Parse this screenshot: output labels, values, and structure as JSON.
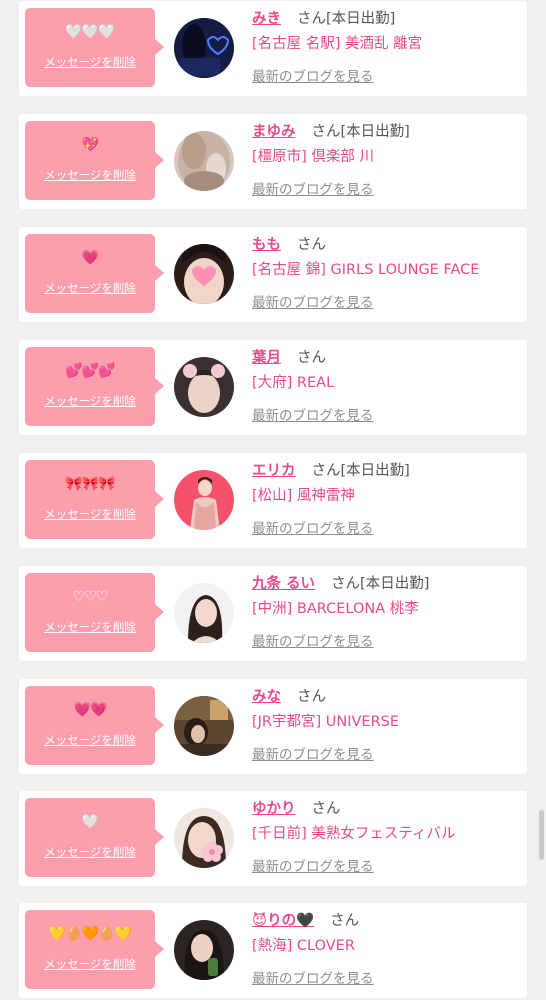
{
  "delete_label": "メッセージを削除",
  "blog_label": "最新のブログを見る",
  "colors": {
    "accent": "#e84a8a",
    "bubble": "#fd9eac",
    "card": "#ffffff",
    "background": "#f0f0f2"
  },
  "items": [
    {
      "emoji": "🤍🤍🤍",
      "name": "みき",
      "status": "さん[本日出勤]",
      "shop": "[名古屋 名駅] 美酒乱 離宮"
    },
    {
      "emoji": "💖",
      "name": "まゆみ",
      "status": "さん[本日出勤]",
      "shop": "[橿原市] 倶楽部 川"
    },
    {
      "emoji": "💗",
      "name": "もも",
      "status": "さん",
      "shop": "[名古屋 錦] GIRLS LOUNGE FACE"
    },
    {
      "emoji": "💕💕💕",
      "name": "葉月",
      "status": "さん",
      "shop": "[大府] REAL"
    },
    {
      "emoji": "🎀🎀🎀",
      "name": "エリカ",
      "status": "さん[本日出勤]",
      "shop": "[松山] 風神雷神"
    },
    {
      "emoji": "♡♡♡",
      "name": "九条 るい",
      "status": "さん[本日出勤]",
      "shop": "[中洲] BARCELONA 桃李"
    },
    {
      "emoji": "💗💗",
      "name": "みな",
      "status": "さん",
      "shop": "[JR宇都宮] UNIVERSE"
    },
    {
      "emoji": "🤍",
      "name": "ゆかり",
      "status": "さん",
      "shop": "[千日前] 美熟女フェスティバル"
    },
    {
      "emoji": "💛🥚🧡🥚💛",
      "name": "😈りの🖤",
      "status": "さん",
      "shop": "[熱海] CLOVER"
    }
  ]
}
